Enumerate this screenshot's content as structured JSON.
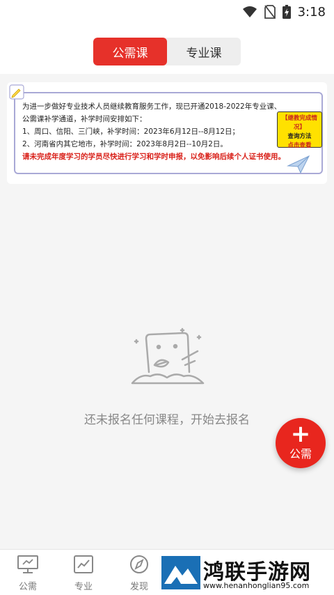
{
  "status_bar": {
    "time": "3:18",
    "icons": [
      "wifi-icon",
      "no-sim-icon",
      "battery-charging-icon"
    ]
  },
  "tabs": [
    {
      "label": "公需课",
      "active": true
    },
    {
      "label": "专业课",
      "active": false
    }
  ],
  "banner": {
    "lines": [
      "为进一步做好专业技术人员继续教育服务工作，现已开通2018-2022年专业课、",
      "公需课补学通道，补学时间安排如下：",
      "1、周口、信阳、三门峡，补学时间：2023年6月12日--8月12日；",
      "2、河南省内其它地市，补学时间：2023年8月2日--10月2日。"
    ],
    "warning": "请未完成年度学习的学员尽快进行学习和学时申报，以免影响后续个人证书使用。",
    "sticker": {
      "line1": "【继教完成情况】",
      "line2": "查询方法",
      "line3": "点击查看"
    }
  },
  "empty_state": {
    "text": "还未报名任何课程，开始去报名"
  },
  "fab": {
    "plus": "+",
    "label": "公需"
  },
  "bottom_nav": [
    {
      "label": "公需",
      "icon": "monitor-icon"
    },
    {
      "label": "专业",
      "icon": "chart-icon"
    },
    {
      "label": "发现",
      "icon": "compass-icon"
    }
  ],
  "watermark": {
    "title": "鸿联手游网",
    "url": "www.henanhonglian95.com"
  },
  "colors": {
    "accent": "#e6312a",
    "banner_border": "#a9a9d6",
    "sticker": "#ffe100"
  }
}
